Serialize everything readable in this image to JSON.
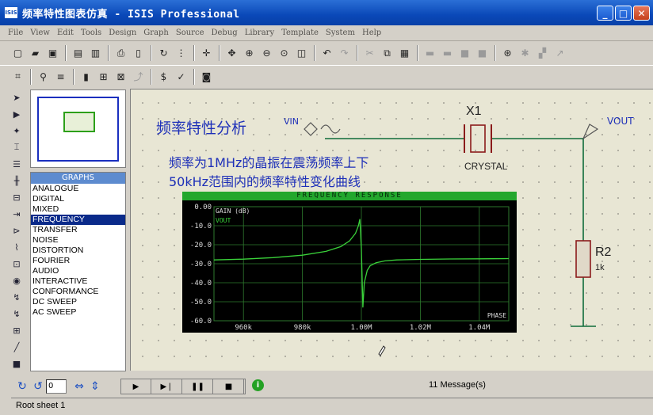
{
  "window": {
    "app_icon_text": "ISIS",
    "title": "频率特性图表仿真 - ISIS Professional",
    "min_glyph": "_",
    "max_glyph": "□",
    "close_glyph": "✕"
  },
  "menu": [
    "File",
    "View",
    "Edit",
    "Tools",
    "Design",
    "Graph",
    "Source",
    "Debug",
    "Library",
    "Template",
    "System",
    "Help"
  ],
  "graphs_panel": {
    "header": "GRAPHS",
    "items": [
      "ANALOGUE",
      "DIGITAL",
      "MIXED",
      "FREQUENCY",
      "TRANSFER",
      "NOISE",
      "DISTORTION",
      "FOURIER",
      "AUDIO",
      "INTERACTIVE",
      "CONFORMANCE",
      "DC SWEEP",
      "AC SWEEP"
    ],
    "selected": "FREQUENCY"
  },
  "schematic": {
    "heading": "频率特性分析",
    "note_line1": "频率为1MHz的晶振在震荡频率上下",
    "note_line2": "50kHz范围内的频率特性变化曲线",
    "vin_label": "VIN",
    "vout_label": "VOUT",
    "x1_ref": "X1",
    "x1_value": "CRYSTAL",
    "r2_ref": "R2",
    "r2_value": "1k"
  },
  "graph": {
    "title": "FREQUENCY RESPONSE",
    "y_axis_title": "GAIN (dB)",
    "trace_name": "VOUT",
    "corner_label": "PHASE",
    "y_ticks": [
      "0.00",
      "-10.0",
      "-20.0",
      "-30.0",
      "-40.0",
      "-50.0",
      "-60.0"
    ],
    "x_ticks": [
      "960k",
      "980k",
      "1.00M",
      "1.02M",
      "1.04M"
    ]
  },
  "chart_data": {
    "type": "line",
    "title": "FREQUENCY RESPONSE",
    "ylabel": "GAIN (dB)",
    "xlabel": "",
    "xlim": [
      950000,
      1050000
    ],
    "ylim": [
      -60,
      0
    ],
    "grid": true,
    "series": [
      {
        "name": "VOUT",
        "color": "#3ad23a",
        "x": [
          950000,
          960000,
          970000,
          980000,
          988000,
          993000,
          996000,
          998000,
          999000,
          999500,
          1000000,
          1000500,
          1001000,
          1002000,
          1003000,
          1005000,
          1008000,
          1012000,
          1020000,
          1030000,
          1040000,
          1050000
        ],
        "y": [
          -28.0,
          -27.6,
          -26.8,
          -25.5,
          -23.5,
          -21.0,
          -18.0,
          -14.0,
          -10.0,
          -6.5,
          -22.0,
          -53.0,
          -40.0,
          -33.5,
          -31.0,
          -29.5,
          -28.5,
          -28.0,
          -27.7,
          -27.5,
          -27.4,
          -27.3
        ]
      }
    ]
  },
  "status": {
    "rotation_value": "0",
    "info_glyph": "i",
    "messages": "11 Message(s)",
    "sheet": "Root sheet 1"
  },
  "colors": {
    "accent": "#0a48b8",
    "annotation": "#1d2fb8",
    "wire": "#0f6b3a",
    "component": "#8b1b1b",
    "graph_grid": "#2e7a2e",
    "graph_trace": "#3ad23a"
  }
}
